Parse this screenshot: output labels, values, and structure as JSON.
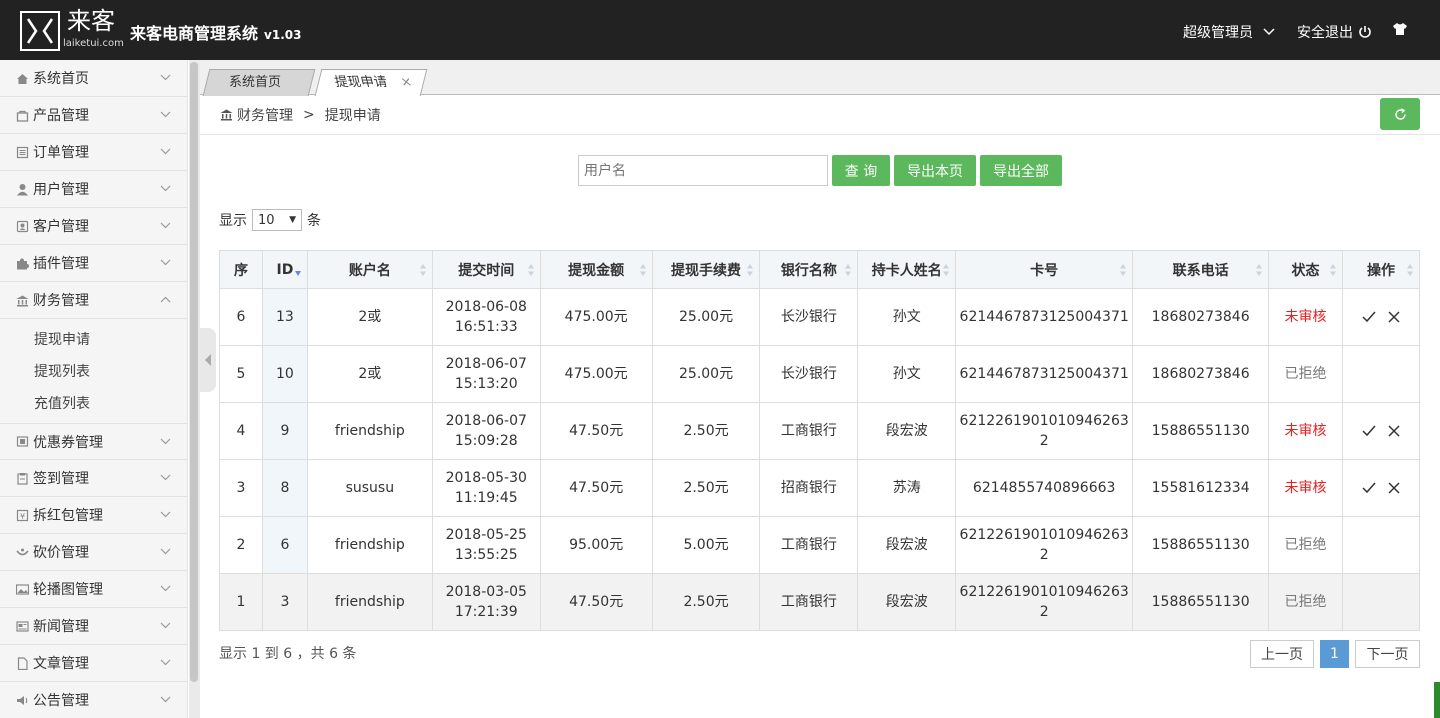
{
  "header": {
    "logo_cn": "来客",
    "logo_en": "laiketui.com",
    "title": "来客电商管理系统",
    "version": "v1.03",
    "admin_label": "超级管理员",
    "logout_label": "安全退出"
  },
  "sidebar": {
    "items": [
      {
        "label": "系统首页",
        "icon": "home-icon"
      },
      {
        "label": "产品管理",
        "icon": "bag-icon"
      },
      {
        "label": "订单管理",
        "icon": "list-icon"
      },
      {
        "label": "用户管理",
        "icon": "user-icon"
      },
      {
        "label": "客户管理",
        "icon": "customer-icon"
      },
      {
        "label": "插件管理",
        "icon": "puzzle-icon"
      },
      {
        "label": "财务管理",
        "icon": "bank-icon"
      },
      {
        "label": "优惠券管理",
        "icon": "coupon-icon"
      },
      {
        "label": "签到管理",
        "icon": "signin-icon"
      },
      {
        "label": "拆红包管理",
        "icon": "redpacket-icon"
      },
      {
        "label": "砍价管理",
        "icon": "cut-icon"
      },
      {
        "label": "轮播图管理",
        "icon": "image-icon"
      },
      {
        "label": "新闻管理",
        "icon": "news-icon"
      },
      {
        "label": "文章管理",
        "icon": "file-icon"
      },
      {
        "label": "公告管理",
        "icon": "speaker-icon"
      }
    ],
    "finance_sub": [
      "提现申请",
      "提现列表",
      "充值列表"
    ]
  },
  "tabs": [
    {
      "label": "系统首页"
    },
    {
      "label": "提现申请"
    }
  ],
  "breadcrumb": {
    "section": "财务管理",
    "separator": ">",
    "page": "提现申请"
  },
  "search": {
    "placeholder": "用户名",
    "query_label": "查 询",
    "export_page_label": "导出本页",
    "export_all_label": "导出全部"
  },
  "page_size": {
    "prefix": "显示",
    "value": "10",
    "suffix": "条"
  },
  "table": {
    "columns": [
      "序",
      "ID",
      "账户名",
      "提交时间",
      "提现金额",
      "提现手续费",
      "银行名称",
      "持卡人姓名",
      "卡号",
      "联系电话",
      "状态",
      "操作"
    ],
    "rows": [
      {
        "seq": "6",
        "id": "13",
        "account": "2或",
        "date": "2018-06-08",
        "time": "16:51:33",
        "amount": "475.00元",
        "fee": "25.00元",
        "bank": "长沙银行",
        "holder": "孙文",
        "card": "6214467873125004371",
        "phone": "18680273846",
        "status": "未审核",
        "pending": true
      },
      {
        "seq": "5",
        "id": "10",
        "account": "2或",
        "date": "2018-06-07",
        "time": "15:13:20",
        "amount": "475.00元",
        "fee": "25.00元",
        "bank": "长沙银行",
        "holder": "孙文",
        "card": "6214467873125004371",
        "phone": "18680273846",
        "status": "已拒绝",
        "pending": false
      },
      {
        "seq": "4",
        "id": "9",
        "account": "friendship",
        "date": "2018-06-07",
        "time": "15:09:28",
        "amount": "47.50元",
        "fee": "2.50元",
        "bank": "工商银行",
        "holder": "段宏波",
        "card": "6212261901010946263 2",
        "phone": "15886551130",
        "status": "未审核",
        "pending": true
      },
      {
        "seq": "3",
        "id": "8",
        "account": "sususu",
        "date": "2018-05-30",
        "time": "11:19:45",
        "amount": "47.50元",
        "fee": "2.50元",
        "bank": "招商银行",
        "holder": "苏涛",
        "card": "6214855740896663",
        "phone": "15581612334",
        "status": "未审核",
        "pending": true
      },
      {
        "seq": "2",
        "id": "6",
        "account": "friendship",
        "date": "2018-05-25",
        "time": "13:55:25",
        "amount": "95.00元",
        "fee": "5.00元",
        "bank": "工商银行",
        "holder": "段宏波",
        "card": "6212261901010946263 2",
        "phone": "15886551130",
        "status": "已拒绝",
        "pending": false
      },
      {
        "seq": "1",
        "id": "3",
        "account": "friendship",
        "date": "2018-03-05",
        "time": "17:21:39",
        "amount": "47.50元",
        "fee": "2.50元",
        "bank": "工商银行",
        "holder": "段宏波",
        "card": "6212261901010946263 2",
        "phone": "15886551130",
        "status": "已拒绝",
        "pending": false
      }
    ]
  },
  "footer": {
    "info": "显示 1 到 6 ，共 6 条",
    "prev_label": "上一页",
    "current_page": "1",
    "next_label": "下一页"
  },
  "colors": {
    "accent_green": "#5cb85c",
    "pending_red": "#e82020",
    "page_blue": "#5b9bd5"
  }
}
